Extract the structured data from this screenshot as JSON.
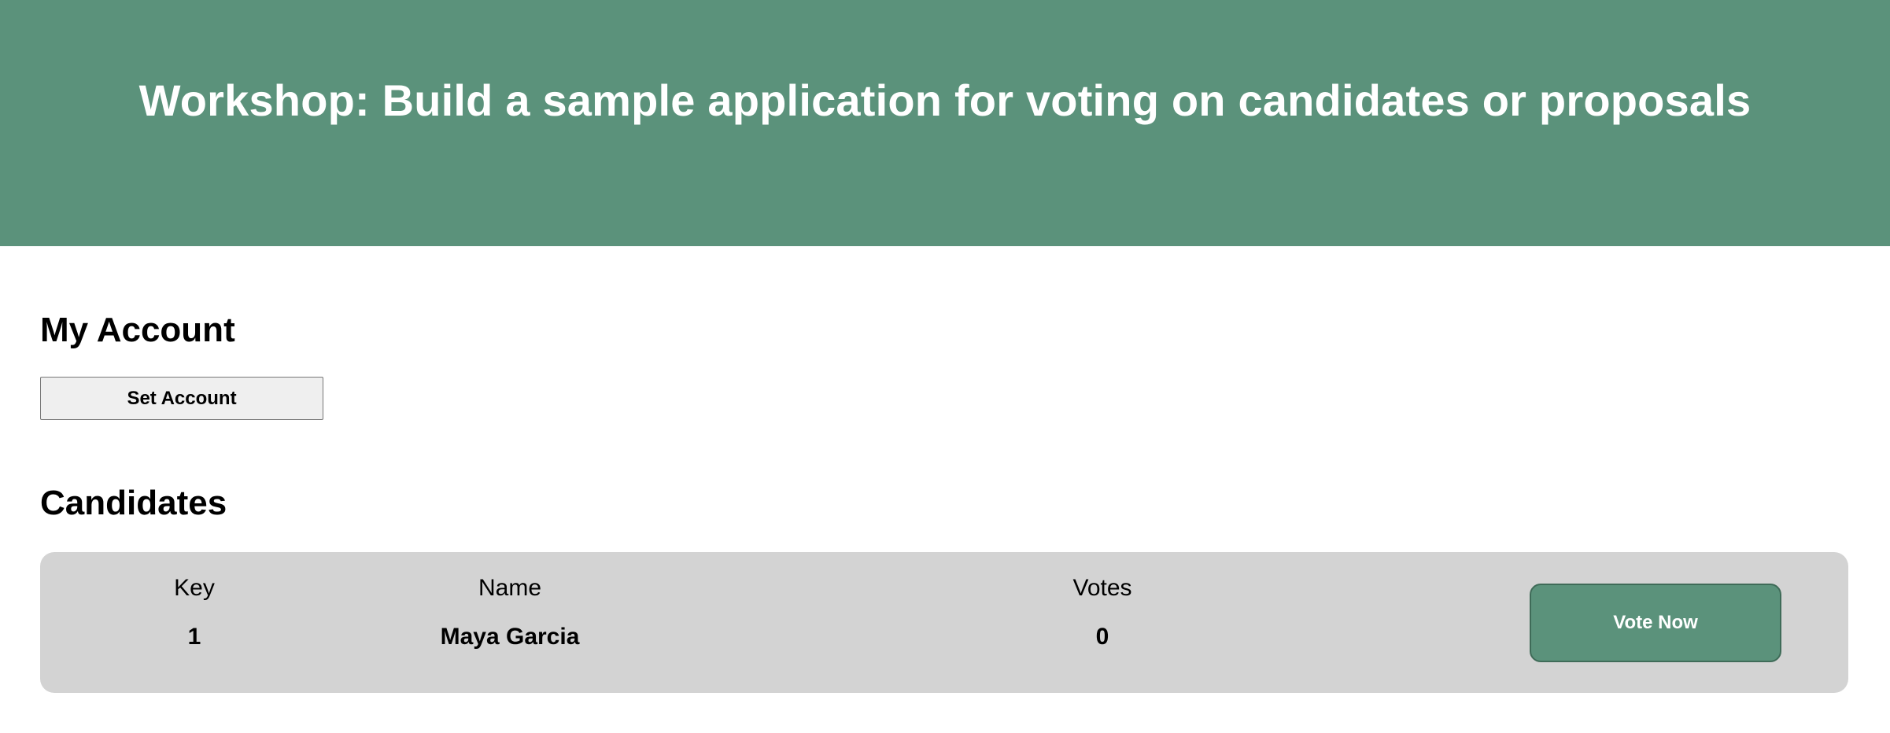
{
  "header": {
    "title": "Workshop: Build a sample application for voting on candidates or proposals"
  },
  "account": {
    "heading": "My Account",
    "set_account_label": "Set Account"
  },
  "candidates": {
    "heading": "Candidates",
    "columns": {
      "key": "Key",
      "name": "Name",
      "votes": "Votes"
    },
    "items": [
      {
        "key": "1",
        "name": "Maya Garcia",
        "votes": "0",
        "vote_label": "Vote Now"
      }
    ]
  },
  "colors": {
    "accent": "#5b927b",
    "card_background": "#d3d3d3",
    "button_background": "#efefef"
  }
}
